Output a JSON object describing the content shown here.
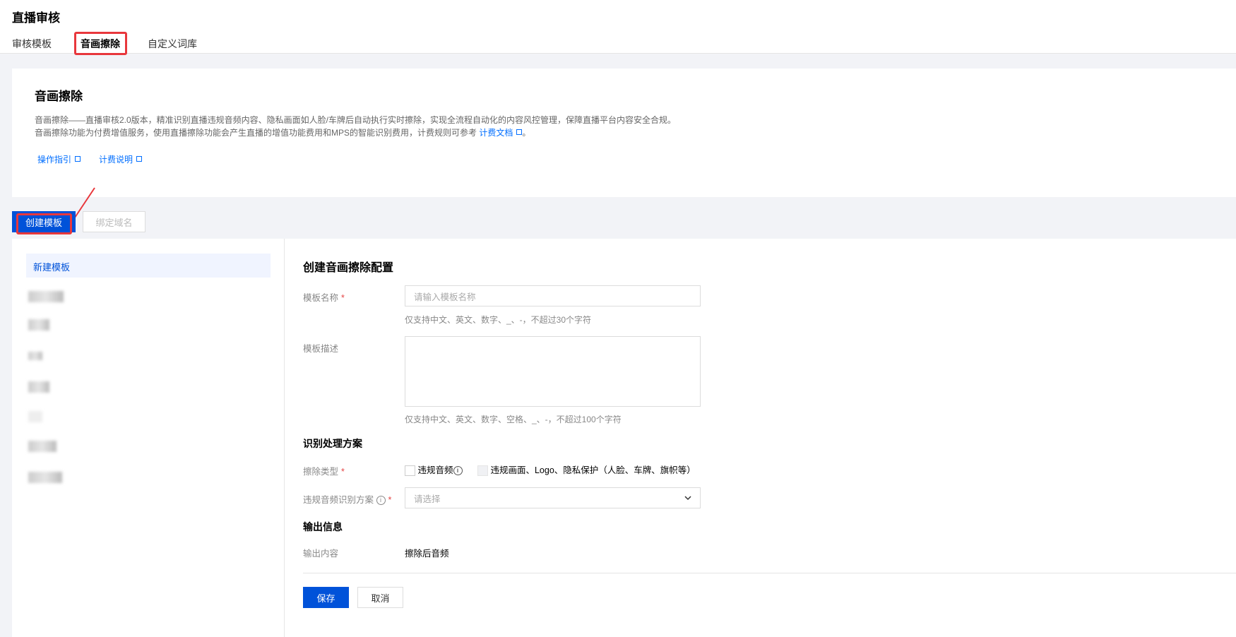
{
  "page_title": "直播审核",
  "tabs": [
    "审核模板",
    "音画擦除",
    "自定义词库"
  ],
  "intro": {
    "title": "音画擦除",
    "line1": "音画擦除——直播审核2.0版本，精准识别直播违规音频内容、隐私画面如人脸/车牌后自动执行实时擦除，实现全流程自动化的内容风控管理，保障直播平台内容安全合规。",
    "line2": "音画擦除功能为付费增值服务，使用直播擦除功能会产生直播的增值功能费用和MPS的智能识别费用，计费规则可参考",
    "line2_link": "计费文档",
    "line2_end": "。",
    "links": [
      "操作指引",
      "计费说明"
    ]
  },
  "toolbar": {
    "create": "创建模板",
    "bind": "绑定域名"
  },
  "sidebar": {
    "new_item": "新建模板"
  },
  "form": {
    "title": "创建音画擦除配置",
    "name_label": "模板名称",
    "name_placeholder": "请输入模板名称",
    "name_hint": "仅支持中文、英文、数字、_、-，不超过30个字符",
    "desc_label": "模板描述",
    "desc_hint": "仅支持中文、英文、数字、空格、_、-，不超过100个字符",
    "section1": "识别处理方案",
    "erase_label": "擦除类型",
    "opt_audio": "违规音频",
    "opt_video": "违规画面、Logo、隐私保护（人脸、车牌、旗帜等）",
    "scheme_label": "违规音频识别方案",
    "scheme_placeholder": "请选择",
    "section2": "输出信息",
    "output_label": "输出内容",
    "output_value": "擦除后音频",
    "save": "保存",
    "cancel": "取消",
    "required_mark": "*",
    "info_glyph": "i"
  }
}
